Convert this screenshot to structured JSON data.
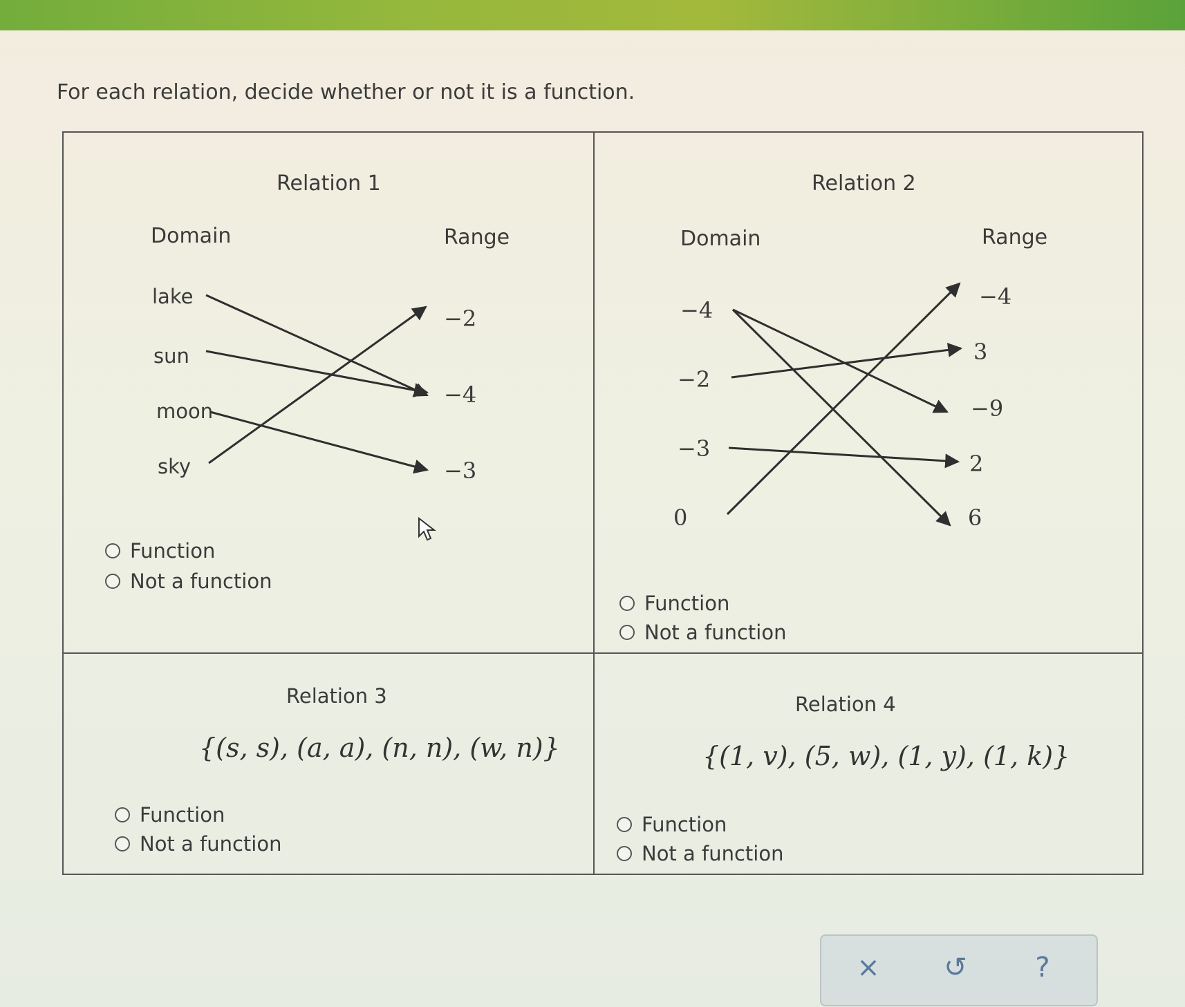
{
  "prompt": "For each relation, decide whether or not it is a function.",
  "relations": [
    {
      "title": "Relation 1",
      "domain_label": "Domain",
      "range_label": "Range",
      "domain": [
        "lake",
        "sun",
        "moon",
        "sky"
      ],
      "range": [
        "−2",
        "−4",
        "−3"
      ],
      "mappings": [
        [
          "lake",
          "−4"
        ],
        [
          "sun",
          "−4"
        ],
        [
          "moon",
          "−3"
        ],
        [
          "sky",
          "−2"
        ]
      ],
      "options": [
        "Function",
        "Not a function"
      ]
    },
    {
      "title": "Relation 2",
      "domain_label": "Domain",
      "range_label": "Range",
      "domain": [
        "−4",
        "−2",
        "−3",
        "0"
      ],
      "range": [
        "−4",
        "3",
        "−9",
        "2",
        "6"
      ],
      "mappings": [
        [
          "−4",
          "−9"
        ],
        [
          "−4",
          "6"
        ],
        [
          "−2",
          "3"
        ],
        [
          "−3",
          "2"
        ],
        [
          "0",
          "−4"
        ]
      ],
      "options": [
        "Function",
        "Not a function"
      ]
    },
    {
      "title": "Relation 3",
      "set": "{(s, s), (a, a), (n, n), (w, n)}",
      "options": [
        "Function",
        "Not a function"
      ]
    },
    {
      "title": "Relation 4",
      "set": "{(1, v), (5, w), (1, y), (1, k)}",
      "options": [
        "Function",
        "Not a function"
      ]
    }
  ],
  "toolbar": {
    "clear_icon": "close-icon",
    "clear_glyph": "×",
    "undo_icon": "undo-icon",
    "undo_glyph": "↺",
    "help_icon": "help-icon",
    "help_glyph": "?"
  },
  "colors": {
    "topbar": "#7cb13c",
    "arrow": "#2f2f2f",
    "link": "#5a7a9c"
  }
}
